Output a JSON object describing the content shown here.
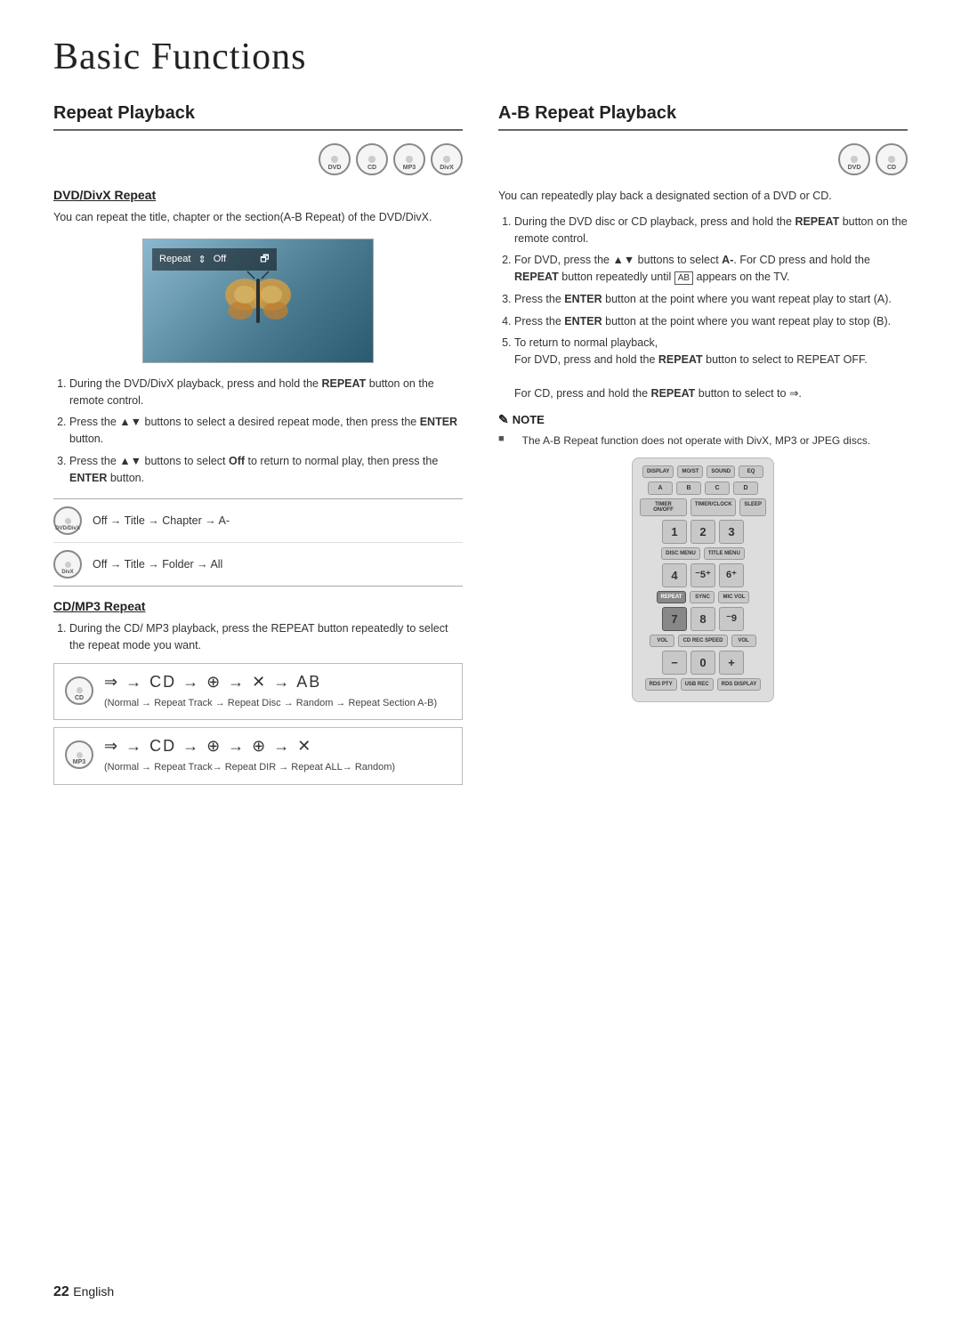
{
  "page": {
    "title": "Basic Functions",
    "page_number": "22",
    "page_number_label": "English"
  },
  "left_section": {
    "title": "Repeat Playback",
    "disc_icons": [
      "DVD",
      "CD",
      "MP3",
      "DivX"
    ],
    "dvd_divx": {
      "subtitle": "DVD/DivX Repeat",
      "body": "You can repeat the title, chapter or the section(A-B Repeat) of the DVD/DivX.",
      "screen_label": "Repeat",
      "screen_value": "Off",
      "steps": [
        "During the DVD/DivX playback, press and hold the REPEAT button on the remote control.",
        "Press the ▲▼ buttons to select a desired repeat mode, then press the ENTER button.",
        "Press the ▲▼ buttons to select Off to return to normal play, then press the ENTER button."
      ],
      "repeat_rows": [
        {
          "disc": "DVD/DivX",
          "sequence": "Off → Title → Chapter → A-"
        },
        {
          "disc": "DivX",
          "sequence": "Off → Title → Folder → All"
        }
      ]
    },
    "cd_mp3": {
      "subtitle": "CD/MP3 Repeat",
      "steps": [
        "During the CD/ MP3 playback, press the REPEAT button repeatedly to select the repeat mode you want."
      ],
      "seq_rows": [
        {
          "disc": "CD",
          "symbol": "⇒ → ① → ⑪ → ✕ → ⑫",
          "label": "(Normal → Repeat Track → Repeat Disc → Random → Repeat Section A-B)"
        },
        {
          "disc": "MP3",
          "symbol": "⇒ → ① → ② → ⑪ → ✕",
          "label": "(Normal → Repeat Track→ Repeat DIR → Repeat ALL→ Random)"
        }
      ]
    }
  },
  "right_section": {
    "title": "A-B Repeat Playback",
    "disc_icons": [
      "DVD",
      "CD"
    ],
    "intro": "You can repeatedly play back a designated section of a DVD or CD.",
    "steps": [
      "During the DVD disc or CD playback, press and hold the REPEAT button on the remote control.",
      "For DVD, press the ▲▼ buttons to select A-. For CD press and hold the REPEAT button repeatedly until AB appears on the TV.",
      "Press the ENTER button at the point where you want repeat play to start (A).",
      "Press the ENTER button at the point where you want repeat play to stop (B).",
      "To return to normal playback, For DVD, press and hold the REPEAT button to select to REPEAT OFF. For CD, press and hold the REPEAT button to select to ⇒."
    ],
    "note": {
      "title": "NOTE",
      "items": [
        "The A-B Repeat function does not operate with DivX, MP3 or JPEG discs."
      ]
    },
    "remote": {
      "rows": [
        [
          "DISPLAY",
          "MO/ST",
          "SOUND",
          "EQ"
        ],
        [
          "A",
          "B",
          "C",
          "D"
        ],
        [
          "TIMER ON/OFF",
          "TIMER/CLOCK",
          "SLEEP"
        ],
        [
          "1",
          "2",
          "3"
        ],
        [
          "DISC MENU",
          "TITLE MENU"
        ],
        [
          "4",
          "5+",
          "6+"
        ],
        [
          "REPEAT",
          "SYNC",
          "MIC VOL"
        ],
        [
          "7",
          "8",
          "9"
        ],
        [
          "VOL",
          "CD REC SPEED",
          "VOL"
        ],
        [
          "-",
          "0",
          "+"
        ],
        [
          "RDS PTY",
          "USB REC",
          "RDS DISPLAY"
        ]
      ]
    }
  }
}
